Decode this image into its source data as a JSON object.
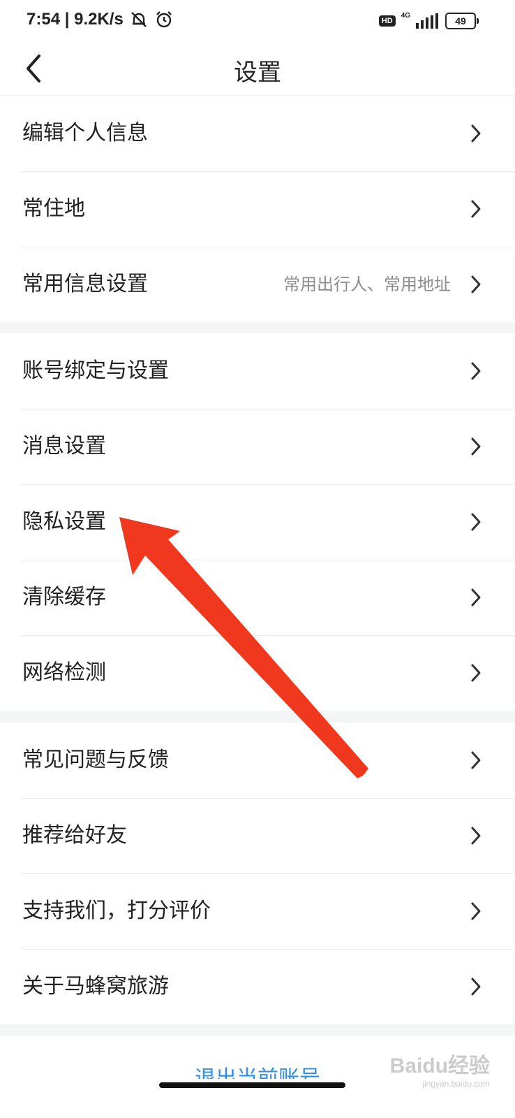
{
  "status_bar": {
    "time": "7:54",
    "speed": "9.2K/s",
    "hd": "HD",
    "network": "4G",
    "battery": "49"
  },
  "header": {
    "title": "设置"
  },
  "groups": [
    {
      "items": [
        {
          "label": "编辑个人信息"
        },
        {
          "label": "常住地"
        },
        {
          "label": "常用信息设置",
          "detail": "常用出行人、常用地址"
        }
      ]
    },
    {
      "items": [
        {
          "label": "账号绑定与设置"
        },
        {
          "label": "消息设置"
        },
        {
          "label": "隐私设置"
        },
        {
          "label": "清除缓存"
        },
        {
          "label": "网络检测"
        }
      ]
    },
    {
      "items": [
        {
          "label": "常见问题与反馈"
        },
        {
          "label": "推荐给好友"
        },
        {
          "label": "支持我们，打分评价"
        },
        {
          "label": "关于马蜂窝旅游"
        }
      ]
    }
  ],
  "logout_label": "退出当前账号",
  "watermark": {
    "text": "Baidu经验",
    "url": "jingyan.baidu.com"
  },
  "colors": {
    "accent": "#2f8fe6",
    "annotation_arrow": "#f0381f"
  }
}
